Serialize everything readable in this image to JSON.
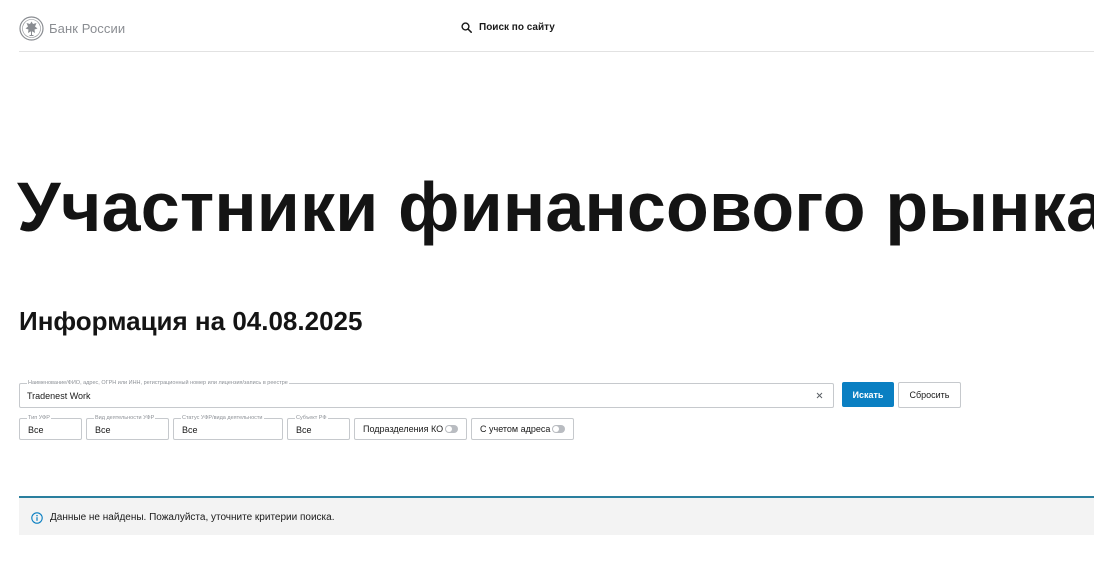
{
  "header": {
    "logo_text": "Банк России",
    "site_search_label": "Поиск по сайту"
  },
  "page": {
    "title": "Участники финансового рынка",
    "info_heading": "Информация на 04.08.2025"
  },
  "search": {
    "label": "Наименование/ФИО, адрес, ОГРН или ИНН, регистрационный номер или лицензия/запись в реестре",
    "value": "Tradenest Work",
    "search_button": "Искать",
    "reset_button": "Сбросить"
  },
  "filters": {
    "type": {
      "label": "Тип УФР",
      "value": "Все"
    },
    "activity": {
      "label": "Вид деятельности УФР",
      "value": "Все"
    },
    "status": {
      "label": "Статус УФР/вида деятельности",
      "value": "Все"
    },
    "region": {
      "label": "Субъект РФ",
      "value": "Все"
    }
  },
  "toggles": {
    "ko_units": {
      "label": "Подразделения КО",
      "on": false
    },
    "with_address": {
      "label": "С учетом адреса",
      "on": false
    }
  },
  "notice": {
    "text": "Данные не найдены. Пожалуйста, уточните критерии поиска."
  },
  "colors": {
    "primary": "#0a7fc2",
    "divider": "#2a7f9e",
    "notice_bg": "#f3f3f3"
  }
}
